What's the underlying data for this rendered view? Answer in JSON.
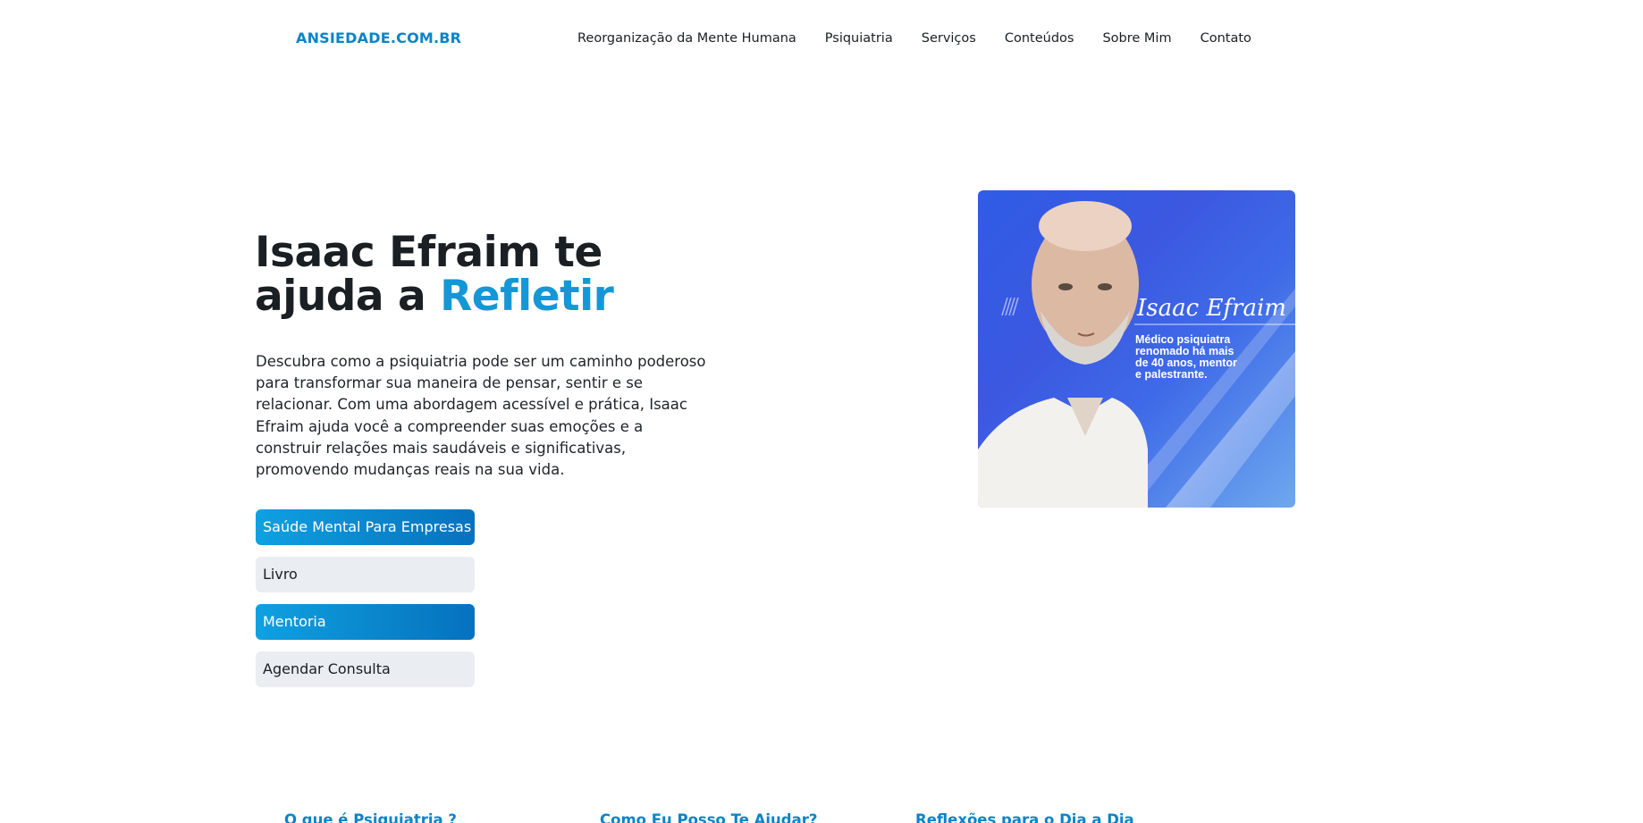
{
  "header": {
    "logo": "ANSIEDADE.COM.BR",
    "nav": [
      "Reorganização da Mente Humana",
      "Psiquiatria",
      "Serviços",
      "Conteúdos",
      "Sobre Mim",
      "Contato"
    ]
  },
  "hero": {
    "title_line1": "Isaac Efraim te",
    "title_line2_prefix": "ajuda a ",
    "title_accent": "Refletir",
    "description": "Descubra como a psiquiatria pode ser um caminho poderoso para transformar sua maneira de pensar, sentir e se relacionar. Com uma abordagem acessível e prática, Isaac Efraim ajuda você a compreender suas emoções e a construir relações mais saudáveis e significativas, promovendo mudanças reais na sua vida.",
    "buttons": [
      {
        "label": "Saúde Mental Para Empresas",
        "style": "primary"
      },
      {
        "label": "Livro",
        "style": "secondary"
      },
      {
        "label": "Mentoria",
        "style": "primary"
      },
      {
        "label": "Agendar Consulta",
        "style": "secondary"
      }
    ]
  },
  "photo": {
    "signature": "Isaac Efraim",
    "caption_lines": [
      "Médico psiquiatra",
      "renomado há mais",
      "de 40 anos, mentor",
      "e palestrante."
    ]
  },
  "bottom_links": [
    "O que é Psiquiatria ?",
    "Como Eu Posso Te Ajudar?",
    "Reflexões para o Dia a Dia"
  ],
  "colors": {
    "accent": "#1597d6",
    "link": "#0a84c8",
    "button_secondary": "#eaedf2"
  }
}
